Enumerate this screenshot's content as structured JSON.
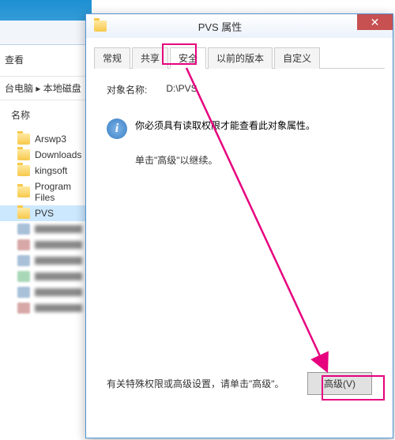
{
  "explorer": {
    "view_label": "查看",
    "path_segment": "台电脑 ▸ 本地磁盘",
    "name_header": "名称",
    "folders": [
      {
        "label": "Arswp3"
      },
      {
        "label": "Downloads"
      },
      {
        "label": "kingsoft"
      },
      {
        "label": "Program Files"
      },
      {
        "label": "PVS"
      }
    ]
  },
  "dialog": {
    "title": "PVS 属性",
    "tabs": {
      "general": "常规",
      "sharing": "共享",
      "security": "安全",
      "previous": "以前的版本",
      "customize": "自定义"
    },
    "object_name_label": "对象名称:",
    "object_name_value": "D:\\PVS",
    "info_msg": "你必须具有读取权限才能查看此对象属性。",
    "continue_msg": "单击\"高级\"以继续。",
    "footer_msg": "有关特殊权限或高级设置，请单击\"高级\"。",
    "advanced_btn": "高级(V)"
  }
}
